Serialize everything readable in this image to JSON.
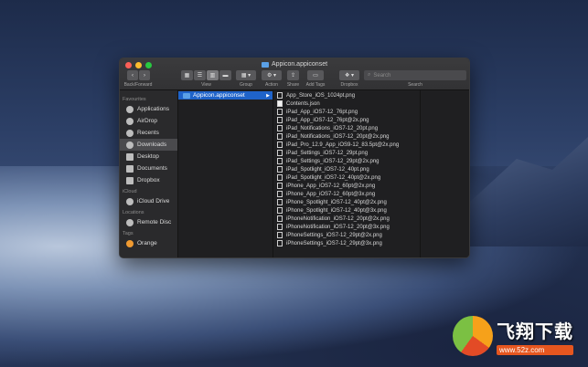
{
  "window": {
    "title": "Appicon.appiconset",
    "search_placeholder": "Search"
  },
  "toolbar": {
    "back_forward_label": "Back/Forward",
    "view_label": "View",
    "group_label": "Group",
    "action_label": "Action",
    "share_label": "Share",
    "add_tags_label": "Add Tags",
    "dropbox_label": "Dropbox",
    "search_label": "Search"
  },
  "sidebar": {
    "favourites_heading": "Favourites",
    "favourites": [
      {
        "label": "Applications",
        "icon": "applications-icon"
      },
      {
        "label": "AirDrop",
        "icon": "airdrop-icon"
      },
      {
        "label": "Recents",
        "icon": "recents-icon"
      },
      {
        "label": "Downloads",
        "icon": "downloads-icon",
        "selected": true
      },
      {
        "label": "Desktop",
        "icon": "desktop-icon"
      },
      {
        "label": "Documents",
        "icon": "documents-icon"
      },
      {
        "label": "Dropbox",
        "icon": "dropbox-icon"
      }
    ],
    "icloud_heading": "iCloud",
    "icloud": [
      {
        "label": "iCloud Drive",
        "icon": "cloud-icon"
      }
    ],
    "locations_heading": "Locations",
    "locations": [
      {
        "label": "Remote Disc",
        "icon": "disc-icon"
      }
    ],
    "tags_heading": "Tags",
    "tags": [
      {
        "label": "Orange",
        "color": "#f09a31"
      }
    ]
  },
  "column1": {
    "selected_folder": "Appicon.appiconset"
  },
  "files": [
    "App_Store_iOS_1024pt.png",
    "Contents.json",
    "iPad_App_iOS7-12_76pt.png",
    "iPad_App_iOS7-12_76pt@2x.png",
    "iPad_Notifications_iOS7-12_20pt.png",
    "iPad_Notifications_iOS7-12_20pt@2x.png",
    "iPad_Pro_12.9_App_iOS9-12_83.5pt@2x.png",
    "iPad_Settings_iOS7-12_29pt.png",
    "iPad_Settings_iOS7-12_29pt@2x.png",
    "iPad_Spotlight_iOS7-12_40pt.png",
    "iPad_Spotlight_iOS7-12_40pt@2x.png",
    "iPhone_App_iOS7-12_60pt@2x.png",
    "iPhone_App_iOS7-12_60pt@3x.png",
    "iPhone_Spotlight_iOS7-12_40pt@2x.png",
    "iPhone_Spotlight_iOS7-12_40pt@3x.png",
    "iPhoneNotification_iOS7-12_20pt@2x.png",
    "iPhoneNotification_iOS7-12_20pt@3x.png",
    "iPhoneSettings_iOS7-12_29pt@2x.png",
    "iPhoneSettings_iOS7-12_29pt@3x.png"
  ],
  "watermark": {
    "brand": "飞翔下载",
    "url": "www.52z.com"
  }
}
